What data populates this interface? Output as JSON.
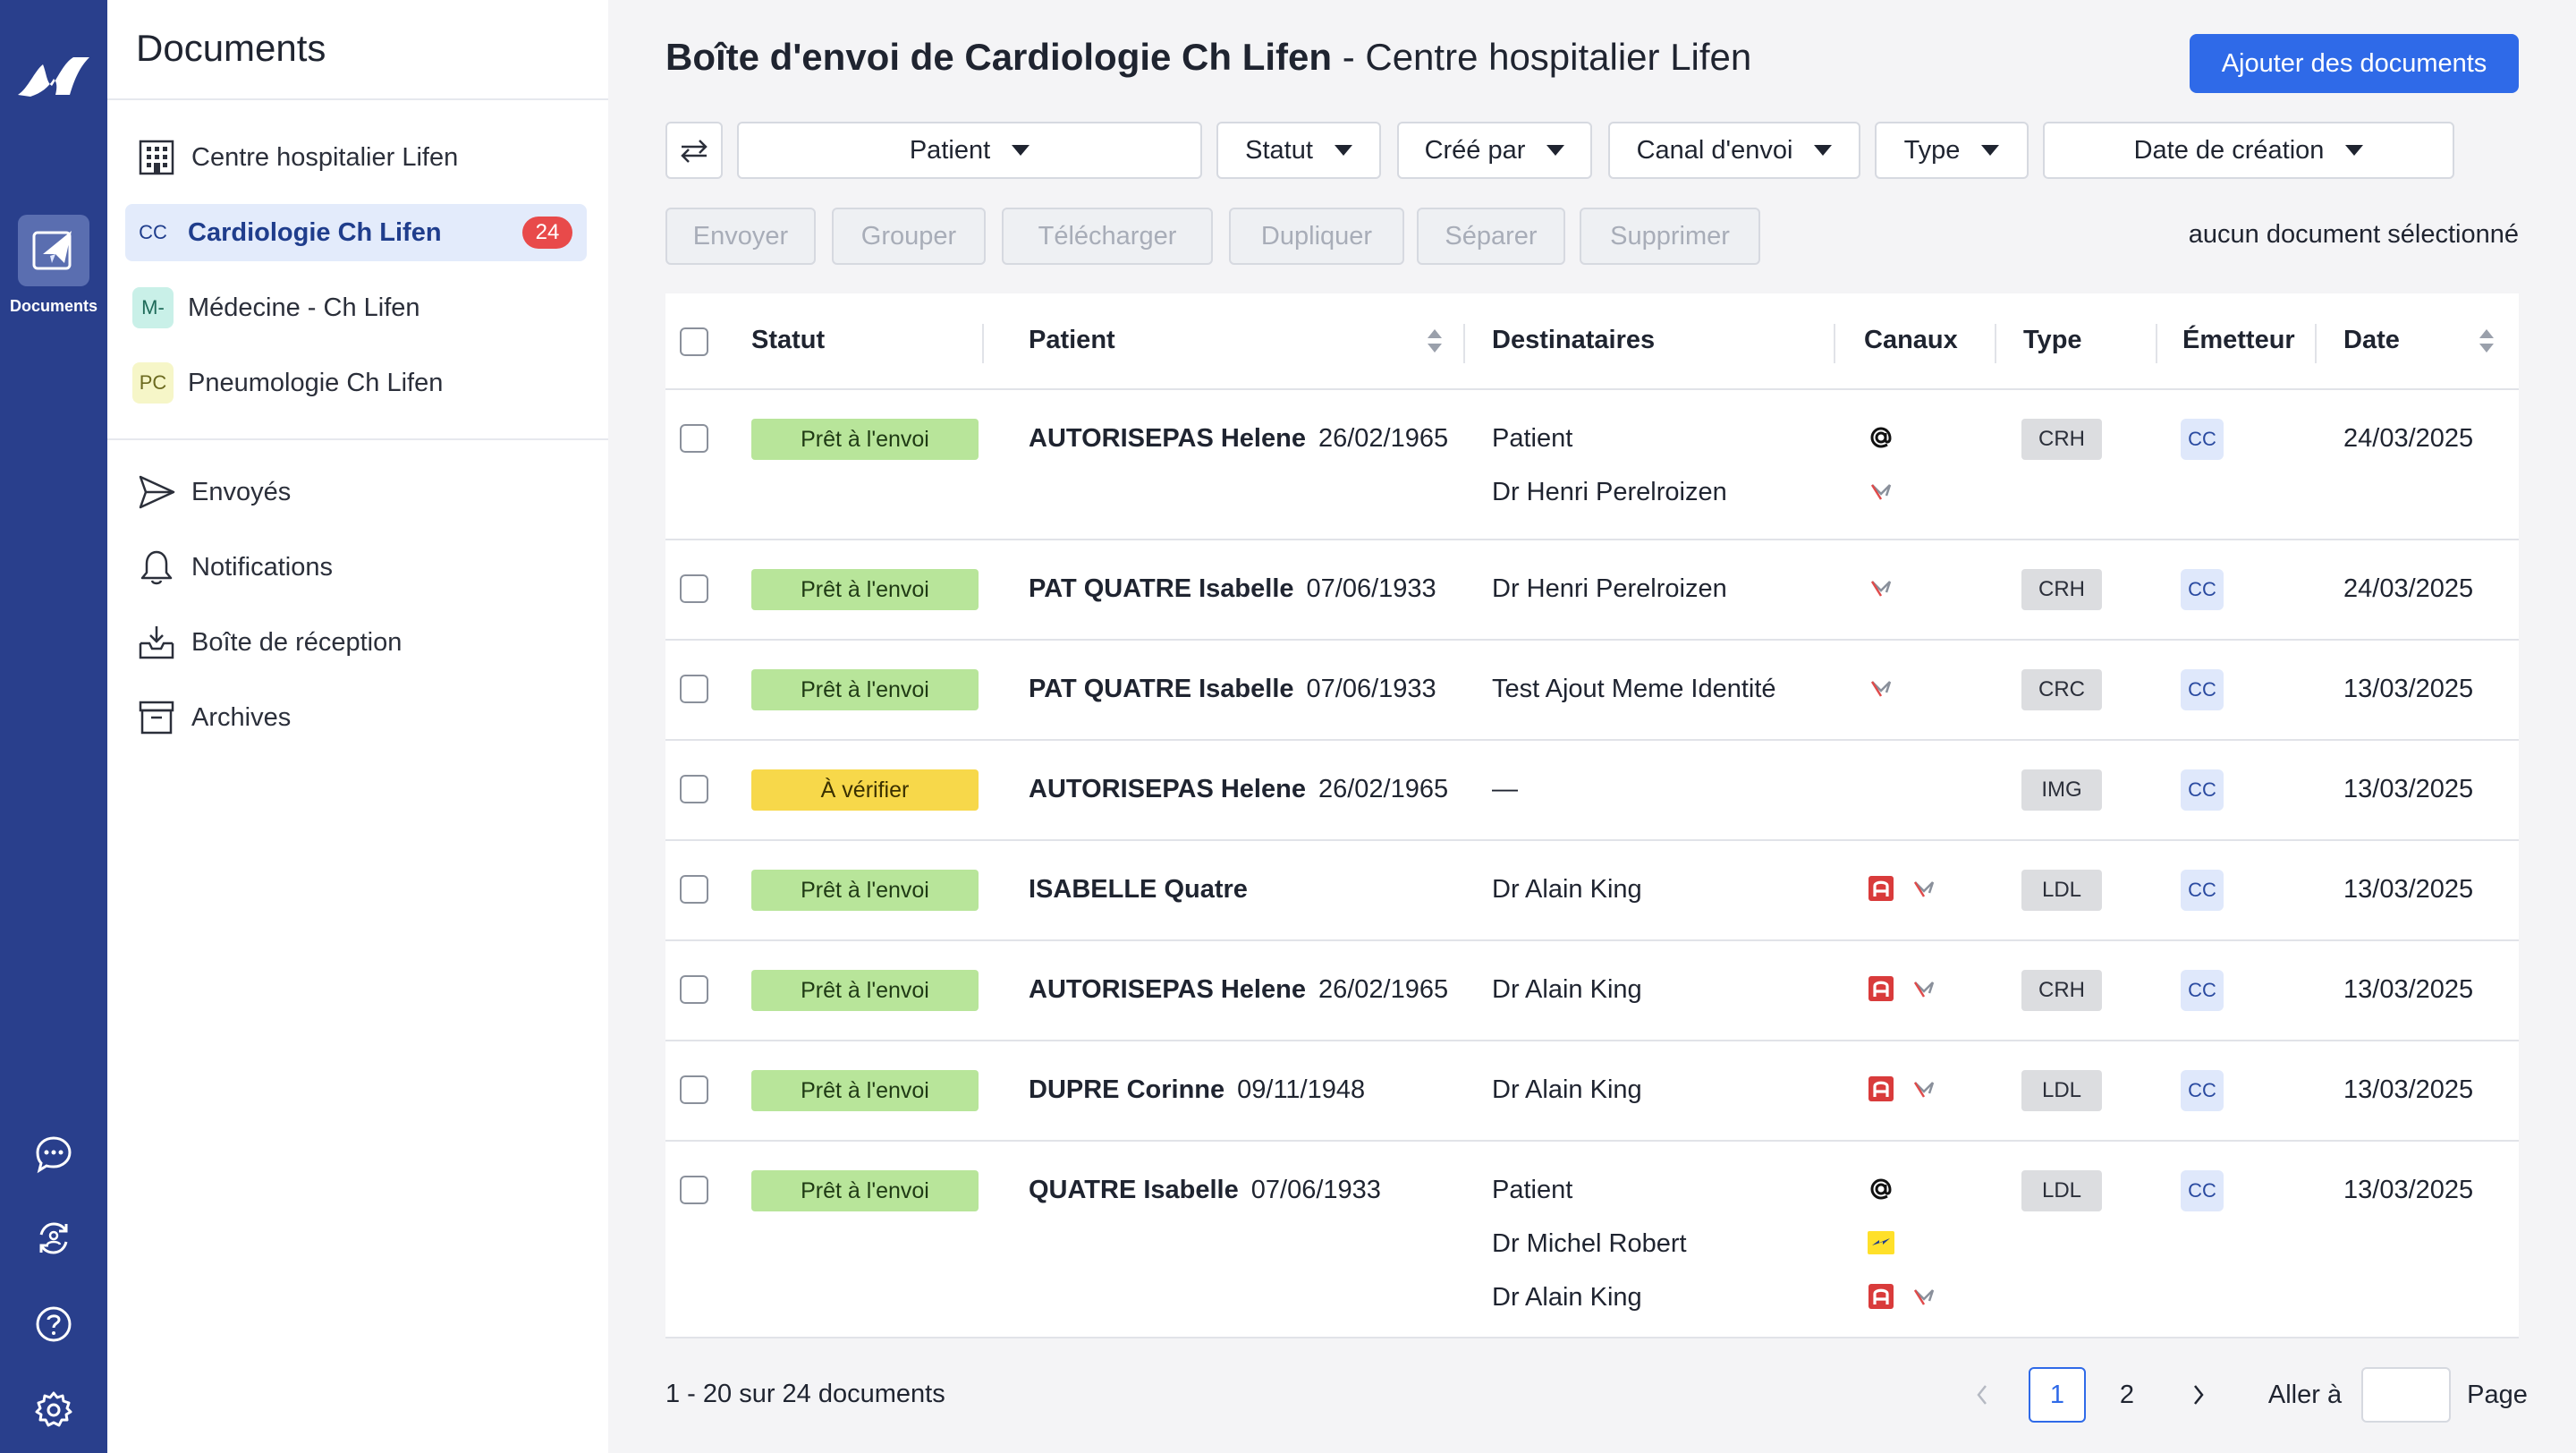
{
  "rail": {
    "documents_label": "Documents"
  },
  "sidebar": {
    "title": "Documents",
    "org": "Centre hospitalier Lifen",
    "services": [
      {
        "abbr": "CC",
        "label": "Cardiologie Ch Lifen",
        "count": "24",
        "abbr_bg": "#e3ebfb",
        "abbr_color": "#1f3d8c"
      },
      {
        "abbr": "M-",
        "label": "Médecine - Ch Lifen",
        "abbr_bg": "#c9f0e8",
        "abbr_color": "#1f6b5a"
      },
      {
        "abbr": "PC",
        "label": "Pneumologie Ch Lifen",
        "abbr_bg": "#f6f6c8",
        "abbr_color": "#6b6a1f"
      }
    ],
    "nav": [
      {
        "icon": "send-icon",
        "label": "Envoyés"
      },
      {
        "icon": "bell-icon",
        "label": "Notifications"
      },
      {
        "icon": "inbox-icon",
        "label": "Boîte de réception"
      },
      {
        "icon": "archive-icon",
        "label": "Archives"
      }
    ]
  },
  "header": {
    "title_bold": "Boîte d'envoi de Cardiologie Ch Lifen",
    "title_sep": " - ",
    "title_rest": "Centre hospitalier Lifen",
    "add_button": "Ajouter des documents"
  },
  "filters": [
    "Patient",
    "Statut",
    "Créé par",
    "Canal d'envoi",
    "Type",
    "Date de création"
  ],
  "actions": [
    "Envoyer",
    "Grouper",
    "Télécharger",
    "Dupliquer",
    "Séparer",
    "Supprimer"
  ],
  "selection_info": "aucun document sélectionné",
  "table": {
    "columns": [
      "Statut",
      "Patient",
      "Destinataires",
      "Canaux",
      "Type",
      "Émetteur",
      "Date"
    ],
    "rows": [
      {
        "status": "Prêt à l'envoi",
        "status_kind": "ready",
        "patient": "AUTORISEPAS Helene",
        "dob": "26/02/1965",
        "recipients": [
          "Patient",
          "Dr Henri Perelroizen"
        ],
        "channels": [
          [
            "email-at-icon"
          ],
          [
            "mssante-icon"
          ]
        ],
        "type": "CRH",
        "emitter": "CC",
        "date": "24/03/2025"
      },
      {
        "status": "Prêt à l'envoi",
        "status_kind": "ready",
        "patient": "PAT QUATRE Isabelle",
        "dob": "07/06/1933",
        "recipients": [
          "Dr Henri Perelroizen"
        ],
        "channels": [
          [
            "mssante-icon"
          ]
        ],
        "type": "CRH",
        "emitter": "CC",
        "date": "24/03/2025"
      },
      {
        "status": "Prêt à l'envoi",
        "status_kind": "ready",
        "patient": "PAT QUATRE Isabelle",
        "dob": "07/06/1933",
        "recipients": [
          "Test Ajout Meme Identité"
        ],
        "channels": [
          [
            "mssante-icon"
          ]
        ],
        "type": "CRC",
        "emitter": "CC",
        "date": "13/03/2025"
      },
      {
        "status": "À vérifier",
        "status_kind": "verify",
        "patient": "AUTORISEPAS Helene",
        "dob": "26/02/1965",
        "recipients": [
          "—"
        ],
        "channels": [
          []
        ],
        "type": "IMG",
        "emitter": "CC",
        "date": "13/03/2025"
      },
      {
        "status": "Prêt à l'envoi",
        "status_kind": "ready",
        "patient": "ISABELLE Quatre",
        "dob": "",
        "recipients": [
          "Dr Alain King"
        ],
        "channels": [
          [
            "apicrypt-icon",
            "mssante-icon"
          ]
        ],
        "type": "LDL",
        "emitter": "CC",
        "date": "13/03/2025"
      },
      {
        "status": "Prêt à l'envoi",
        "status_kind": "ready",
        "patient": "AUTORISEPAS Helene",
        "dob": "26/02/1965",
        "recipients": [
          "Dr Alain King"
        ],
        "channels": [
          [
            "apicrypt-icon",
            "mssante-icon"
          ]
        ],
        "type": "CRH",
        "emitter": "CC",
        "date": "13/03/2025"
      },
      {
        "status": "Prêt à l'envoi",
        "status_kind": "ready",
        "patient": "DUPRE Corinne",
        "dob": "09/11/1948",
        "recipients": [
          "Dr Alain King"
        ],
        "channels": [
          [
            "apicrypt-icon",
            "mssante-icon"
          ]
        ],
        "type": "LDL",
        "emitter": "CC",
        "date": "13/03/2025"
      },
      {
        "status": "Prêt à l'envoi",
        "status_kind": "ready",
        "patient": "QUATRE Isabelle",
        "dob": "07/06/1933",
        "recipients": [
          "Patient",
          "Dr Michel Robert",
          "Dr Alain King"
        ],
        "channels": [
          [
            "email-at-icon"
          ],
          [
            "la-poste-icon"
          ],
          [
            "apicrypt-icon",
            "mssante-icon"
          ]
        ],
        "type": "LDL",
        "emitter": "CC",
        "date": "13/03/2025"
      }
    ]
  },
  "footer": {
    "count_text": "1 - 20 sur 24 documents",
    "pages": [
      "1",
      "2"
    ],
    "current_page": "1",
    "goto_label": "Aller à",
    "page_label": "Page"
  },
  "colors": {
    "rail": "#293f8c",
    "primary": "#2f6ae8",
    "status_ready": "#b8e59a",
    "status_verify": "#f7d84a",
    "count_badge": "#e84a4a"
  }
}
